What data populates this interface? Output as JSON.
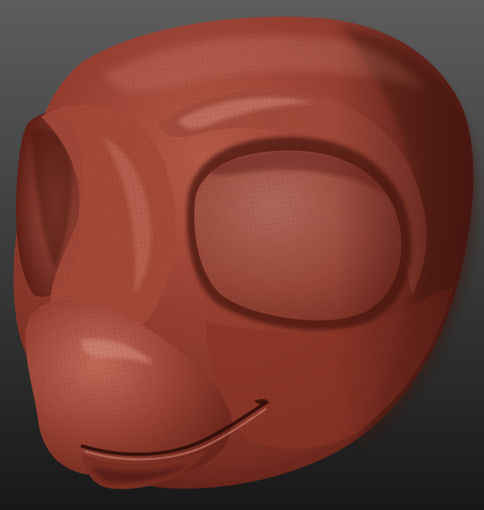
{
  "scene": {
    "subject": "sculpted-head-model",
    "background": {
      "top": "#5d5d5d",
      "bottom": "#181818"
    },
    "material": {
      "base": "#8e3a2e",
      "highlight": "#c9786a",
      "midtone": "#a24a3c",
      "shadow": "#4a1610",
      "deep_shadow": "#2a0a06",
      "wire": "#6e2a20"
    }
  }
}
